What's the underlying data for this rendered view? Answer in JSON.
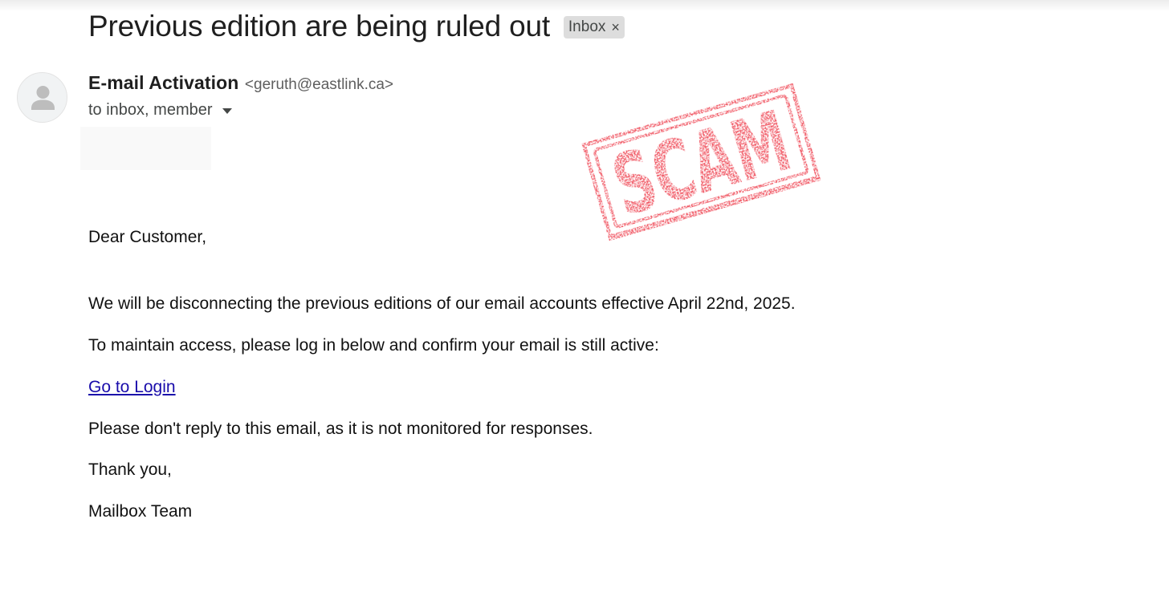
{
  "email": {
    "subject": "Previous edition are being ruled out",
    "label": {
      "text": "Inbox",
      "remove_symbol": "×"
    },
    "sender": {
      "name": "E-mail Activation",
      "address": "<geruth@eastlink.ca>"
    },
    "recipients": "to inbox, member",
    "avatar_icon": "person-icon",
    "stamp": {
      "text": "SCAM",
      "color": "#f0525f"
    },
    "body": {
      "greeting": "Dear Customer,",
      "paragraph_1": "We will be disconnecting the previous editions of our email accounts effective April 22nd, 2025.",
      "paragraph_2": "To maintain access, please log in below and confirm your email is still active:",
      "link_text": "Go to Login",
      "paragraph_3": "Please don't  reply to this email, as it is not monitored for responses.",
      "closing": "Thank you,",
      "signature": "Mailbox Team"
    }
  },
  "colors": {
    "link": "#1a0dab",
    "chip_background": "#dddddd",
    "stamp": "#f0525f"
  }
}
